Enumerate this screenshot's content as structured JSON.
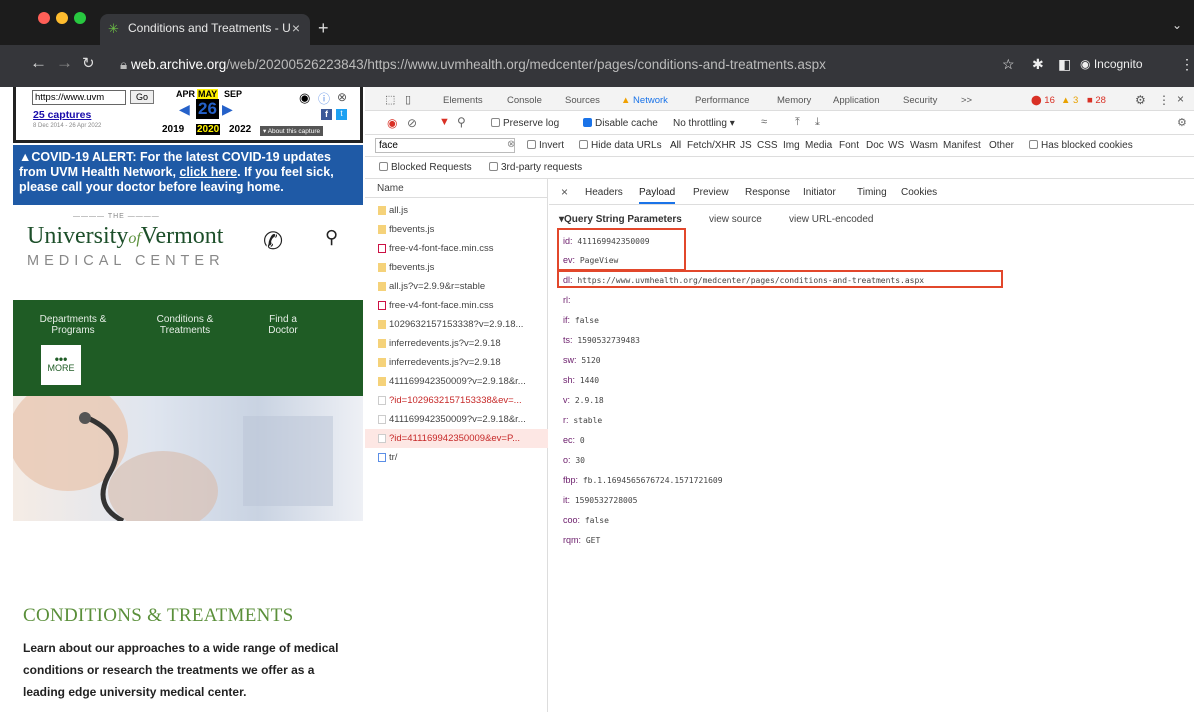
{
  "browser": {
    "tab_title": "Conditions and Treatments - U",
    "url_host": "web.archive.org",
    "url_path": "/web/20200526223843/https://www.uvmhealth.org/medcenter/pages/conditions-and-treatments.aspx",
    "mode": "Incognito"
  },
  "wayback": {
    "url_input": "https://www.uvm",
    "go": "Go",
    "captures": "25 captures",
    "range": "8 Dec 2014 - 26 Apr 2022",
    "months": [
      "APR",
      "MAY",
      "SEP"
    ],
    "day": "26",
    "years": [
      "2019",
      "2020",
      "2022"
    ],
    "about": "About this capture"
  },
  "site": {
    "covid_prefix": "COVID-19 ALERT: For the latest COVID-19 updates from UVM Health Network, ",
    "covid_link": "click here",
    "covid_suffix": ". If you feel sick, please call your doctor before leaving home.",
    "logo_the": "THE",
    "logo_name1": "University",
    "logo_of": "of",
    "logo_name2": "Vermont",
    "logo_sub": "MEDICAL CENTER",
    "nav": [
      {
        "line1": "Departments &",
        "line2": "Programs"
      },
      {
        "line1": "Conditions &",
        "line2": "Treatments"
      },
      {
        "line1": "Find a",
        "line2": "Doctor"
      }
    ],
    "more": "MORE",
    "section_title": "CONDITIONS & TREATMENTS",
    "section_text": "Learn about our approaches to a wide range of medical conditions or research the treatments we offer as a leading edge university medical center."
  },
  "devtools": {
    "tabs": [
      "Elements",
      "Console",
      "Sources",
      "Network",
      "Performance",
      "Memory",
      "Application",
      "Security",
      ">>"
    ],
    "errors": "16",
    "warnings": "3",
    "issues": "28",
    "preserve_log": "Preserve log",
    "disable_cache": "Disable cache",
    "throttling": "No throttling",
    "filter_value": "face",
    "invert": "Invert",
    "hide_data": "Hide data URLs",
    "filters": [
      "All",
      "Fetch/XHR",
      "JS",
      "CSS",
      "Img",
      "Media",
      "Font",
      "Doc",
      "WS",
      "Wasm",
      "Manifest",
      "Other"
    ],
    "blocked_cookies": "Has blocked cookies",
    "blocked_requests": "Blocked Requests",
    "third_party": "3rd-party requests",
    "name_header": "Name",
    "requests": [
      "all.js",
      "fbevents.js",
      "free-v4-font-face.min.css",
      "fbevents.js",
      "all.js?v=2.9.9&r=stable",
      "free-v4-font-face.min.css",
      "1029632157153338?v=2.9.18...",
      "inferredevents.js?v=2.9.18",
      "inferredevents.js?v=2.9.18",
      "411169942350009?v=2.9.18&r...",
      "?id=1029632157153338&ev=...",
      "411169942350009?v=2.9.18&r...",
      "?id=411169942350009&ev=P...",
      "tr/"
    ],
    "detail_tabs": [
      "×",
      "Headers",
      "Payload",
      "Preview",
      "Response",
      "Initiator",
      "Timing",
      "Cookies"
    ],
    "qs_title": "Query String Parameters",
    "view_source": "view source",
    "view_url": "view URL-encoded",
    "params": [
      {
        "k": "id:",
        "v": "411169942350009"
      },
      {
        "k": "ev:",
        "v": "PageView"
      },
      {
        "k": "dl:",
        "v": "https://www.uvmhealth.org/medcenter/pages/conditions-and-treatments.aspx"
      },
      {
        "k": "rl:",
        "v": ""
      },
      {
        "k": "if:",
        "v": "false"
      },
      {
        "k": "ts:",
        "v": "1590532739483"
      },
      {
        "k": "sw:",
        "v": "5120"
      },
      {
        "k": "sh:",
        "v": "1440"
      },
      {
        "k": "v:",
        "v": "2.9.18"
      },
      {
        "k": "r:",
        "v": "stable"
      },
      {
        "k": "ec:",
        "v": "0"
      },
      {
        "k": "o:",
        "v": "30"
      },
      {
        "k": "fbp:",
        "v": "fb.1.1694565676724.1571721609"
      },
      {
        "k": "it:",
        "v": "1590532728005"
      },
      {
        "k": "coo:",
        "v": "false"
      },
      {
        "k": "rqm:",
        "v": "GET"
      }
    ]
  }
}
